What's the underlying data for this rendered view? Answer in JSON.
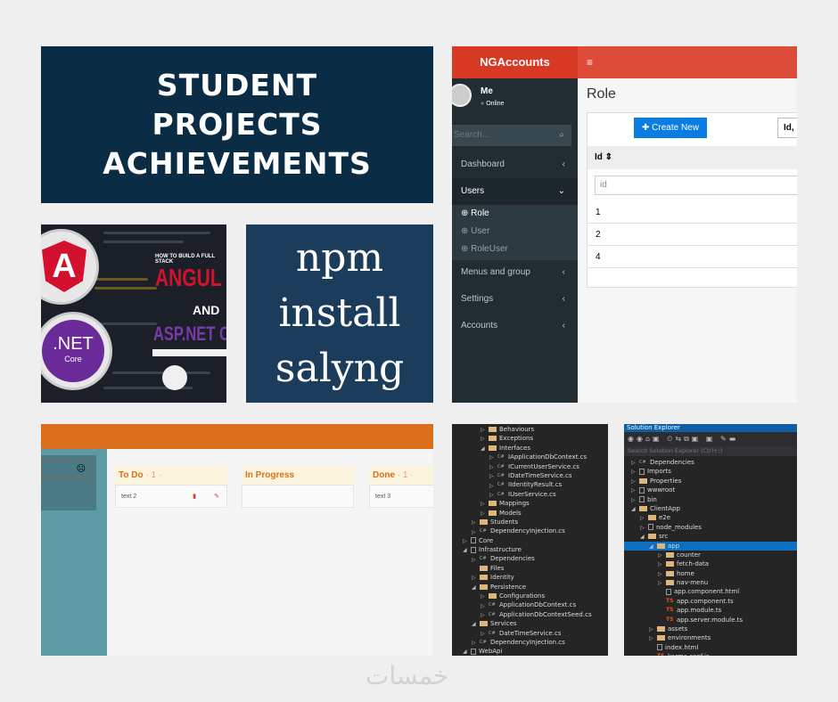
{
  "title_lines": [
    "STUDENT",
    "PROJECTS",
    "ACHIEVEMENTS"
  ],
  "angular_thumb": {
    "subtitle": "HOW TO BUILD A FULL STACK",
    "word1": "ANGUL",
    "and": "AND",
    "word2": "ASP.NET CO",
    "angular_logo": "A",
    "net_logo": ".NET",
    "net_sub": "Core"
  },
  "npm_lines": [
    "npm",
    "install",
    "salyng"
  ],
  "ngaccounts": {
    "brand": "NGAccounts",
    "menu_icon": "hamburger-icon",
    "user": "Me",
    "status": "Online",
    "search_placeholder": "Search...",
    "nav": [
      {
        "label": "Dashboard",
        "chev": "‹"
      },
      {
        "label": "Users",
        "chev": "⌄"
      },
      {
        "label": "Menus and group",
        "chev": "‹"
      },
      {
        "label": "Settings",
        "chev": "‹"
      },
      {
        "label": "Accounts",
        "chev": "‹"
      }
    ],
    "subnav": [
      "Role",
      "User",
      "RoleUser"
    ],
    "page_title": "Role",
    "create_button": "Create New",
    "select_value": "Id,",
    "column": "Id",
    "filter_placeholder": "id",
    "rows": [
      "1",
      "2",
      "4"
    ],
    "colors": {
      "header": "#dd4b39",
      "sidebar": "#222d32",
      "button": "#0a7de0"
    }
  },
  "kanban": {
    "header_color": "#dc6f1e",
    "columns": [
      {
        "title": "To Do",
        "count": "· 1 ·",
        "card": "text 2"
      },
      {
        "title": "In Progress",
        "count": "",
        "card": ""
      },
      {
        "title": "Done",
        "count": "· 1 ·",
        "card": "text 3"
      }
    ]
  },
  "vs_left": [
    {
      "d": 3,
      "t": "folder",
      "x": "▷",
      "n": "Behaviours"
    },
    {
      "d": 3,
      "t": "folder",
      "x": "▷",
      "n": "Exceptions"
    },
    {
      "d": 3,
      "t": "folder",
      "x": "◢",
      "n": "Interfaces"
    },
    {
      "d": 4,
      "t": "cs",
      "x": "▷",
      "n": "IApplicationDbContext.cs"
    },
    {
      "d": 4,
      "t": "cs",
      "x": "▷",
      "n": "ICurrentUserService.cs"
    },
    {
      "d": 4,
      "t": "cs",
      "x": "▷",
      "n": "IDateTimeService.cs"
    },
    {
      "d": 4,
      "t": "cs",
      "x": "▷",
      "n": "IIdentityResult.cs"
    },
    {
      "d": 4,
      "t": "cs",
      "x": "▷",
      "n": "IUserService.cs"
    },
    {
      "d": 3,
      "t": "folder",
      "x": "▷",
      "n": "Mappings"
    },
    {
      "d": 3,
      "t": "folder",
      "x": "▷",
      "n": "Models"
    },
    {
      "d": 2,
      "t": "folder",
      "x": "▷",
      "n": "Students"
    },
    {
      "d": 2,
      "t": "cs",
      "x": "▷",
      "n": "DependencyInjection.cs"
    },
    {
      "d": 1,
      "t": "file",
      "x": "▷",
      "n": "Core"
    },
    {
      "d": 1,
      "t": "file",
      "x": "◢",
      "n": "Infrastructure"
    },
    {
      "d": 2,
      "t": "cs",
      "x": "▷",
      "n": "Dependencies"
    },
    {
      "d": 2,
      "t": "folder",
      "x": "",
      "n": "Files"
    },
    {
      "d": 2,
      "t": "folder",
      "x": "▷",
      "n": "Identity"
    },
    {
      "d": 2,
      "t": "folder",
      "x": "◢",
      "n": "Persistence"
    },
    {
      "d": 3,
      "t": "folder",
      "x": "▷",
      "n": "Configurations"
    },
    {
      "d": 3,
      "t": "cs",
      "x": "▷",
      "n": "ApplicationDbContext.cs"
    },
    {
      "d": 3,
      "t": "cs",
      "x": "▷",
      "n": "ApplicationDbContextSeed.cs"
    },
    {
      "d": 2,
      "t": "folder",
      "x": "◢",
      "n": "Services"
    },
    {
      "d": 3,
      "t": "cs",
      "x": "▷",
      "n": "DateTimeService.cs"
    },
    {
      "d": 2,
      "t": "cs",
      "x": "▷",
      "n": "DependencyInjection.cs"
    },
    {
      "d": 1,
      "t": "file",
      "x": "◢",
      "n": "WebApi"
    }
  ],
  "vs_right": {
    "title": "Solution Explorer",
    "search_placeholder": "Search Solution Explorer (Ctrl+;)",
    "items": [
      {
        "d": 1,
        "t": "cs",
        "x": "▷",
        "n": "Dependencies"
      },
      {
        "d": 1,
        "t": "file",
        "x": "▷",
        "n": "Imports"
      },
      {
        "d": 1,
        "t": "folder",
        "x": "▷",
        "n": "Properties"
      },
      {
        "d": 1,
        "t": "file",
        "x": "▷",
        "n": "wwwroot"
      },
      {
        "d": 1,
        "t": "file",
        "x": "▷",
        "n": "bin"
      },
      {
        "d": 1,
        "t": "folder",
        "x": "◢",
        "n": "ClientApp"
      },
      {
        "d": 2,
        "t": "folder",
        "x": "▷",
        "n": "e2e"
      },
      {
        "d": 2,
        "t": "file",
        "x": "▷",
        "n": "node_modules"
      },
      {
        "d": 2,
        "t": "folder",
        "x": "◢",
        "n": "src"
      },
      {
        "d": 3,
        "t": "folder",
        "x": "◢",
        "n": "app",
        "sel": true
      },
      {
        "d": 4,
        "t": "folder",
        "x": "▷",
        "n": "counter"
      },
      {
        "d": 4,
        "t": "folder",
        "x": "▷",
        "n": "fetch-data"
      },
      {
        "d": 4,
        "t": "folder",
        "x": "▷",
        "n": "home"
      },
      {
        "d": 4,
        "t": "folder",
        "x": "▷",
        "n": "nav-menu"
      },
      {
        "d": 4,
        "t": "file",
        "x": "",
        "n": "app.component.html"
      },
      {
        "d": 4,
        "t": "ts",
        "x": "",
        "n": "app.component.ts"
      },
      {
        "d": 4,
        "t": "ts",
        "x": "",
        "n": "app.module.ts"
      },
      {
        "d": 4,
        "t": "ts",
        "x": "",
        "n": "app.server.module.ts"
      },
      {
        "d": 3,
        "t": "folder",
        "x": "▷",
        "n": "assets"
      },
      {
        "d": 3,
        "t": "folder",
        "x": "▷",
        "n": "environments"
      },
      {
        "d": 3,
        "t": "file",
        "x": "",
        "n": "index.html"
      },
      {
        "d": 3,
        "t": "ts",
        "x": "",
        "n": "karma.conf.js"
      }
    ]
  },
  "watermark": "خمسات"
}
